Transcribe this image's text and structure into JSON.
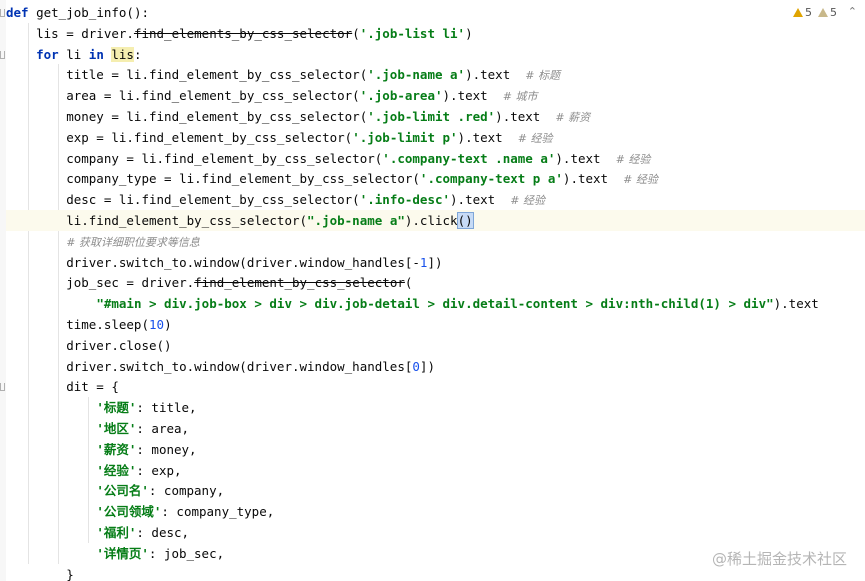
{
  "editor": {
    "lines": [
      [
        {
          "t": "def ",
          "c": "kw"
        },
        {
          "t": "get_job_info():"
        }
      ],
      [
        {
          "t": "    lis = driver."
        },
        {
          "t": "find_elements_by_css_selector",
          "c": "dep"
        },
        {
          "t": "("
        },
        {
          "t": "'.job-list li'",
          "c": "str"
        },
        {
          "t": ")"
        }
      ],
      [
        {
          "t": "    "
        },
        {
          "t": "for ",
          "c": "kw"
        },
        {
          "t": "li "
        },
        {
          "t": "in ",
          "c": "kw"
        },
        {
          "t": "lis",
          "c": "hl-var"
        },
        {
          "t": ":"
        }
      ],
      [
        {
          "t": "        title = li.find_element_by_css_selector("
        },
        {
          "t": "'.job-name a'",
          "c": "str"
        },
        {
          "t": ").text  "
        },
        {
          "t": "# 标题",
          "c": "cmt"
        }
      ],
      [
        {
          "t": "        area = li.find_element_by_css_selector("
        },
        {
          "t": "'.job-area'",
          "c": "str"
        },
        {
          "t": ").text  "
        },
        {
          "t": "# 城市",
          "c": "cmt"
        }
      ],
      [
        {
          "t": "        money = li.find_element_by_css_selector("
        },
        {
          "t": "'.job-limit .red'",
          "c": "str"
        },
        {
          "t": ").text  "
        },
        {
          "t": "# 薪资",
          "c": "cmt"
        }
      ],
      [
        {
          "t": "        exp = li.find_element_by_css_selector("
        },
        {
          "t": "'.job-limit p'",
          "c": "str"
        },
        {
          "t": ").text  "
        },
        {
          "t": "# 经验",
          "c": "cmt"
        }
      ],
      [
        {
          "t": "        company = li.find_element_by_css_selector("
        },
        {
          "t": "'.company-text .name a'",
          "c": "str"
        },
        {
          "t": ").text  "
        },
        {
          "t": "# 经验",
          "c": "cmt"
        }
      ],
      [
        {
          "t": "        company_type = li.find_element_by_css_selector("
        },
        {
          "t": "'.company-text p a'",
          "c": "str"
        },
        {
          "t": ").text  "
        },
        {
          "t": "# 经验",
          "c": "cmt"
        }
      ],
      [
        {
          "t": "        desc = li.find_element_by_css_selector("
        },
        {
          "t": "'.info-desc'",
          "c": "str"
        },
        {
          "t": ").text  "
        },
        {
          "t": "# 经验",
          "c": "cmt"
        }
      ],
      [
        {
          "t": "        li.find_element_by_css_selector("
        },
        {
          "t": "\".job-name a\"",
          "c": "str"
        },
        {
          "t": ").click"
        },
        {
          "t": "()",
          "c": "paren-match"
        },
        {
          "t": "",
          "c": "caret"
        }
      ],
      [
        {
          "t": "        "
        },
        {
          "t": "# 获取详细职位要求等信息",
          "c": "cmt"
        }
      ],
      [
        {
          "t": "        driver.switch_to.window(driver.window_handles[-"
        },
        {
          "t": "1",
          "c": "num"
        },
        {
          "t": "])"
        }
      ],
      [
        {
          "t": "        job_sec = driver."
        },
        {
          "t": "find_element_by_css_selector",
          "c": "dep"
        },
        {
          "t": "("
        }
      ],
      [
        {
          "t": "            "
        },
        {
          "t": "\"#main > div.job-box > div > div.job-detail > div.detail-content > div:nth-child(1) > div\"",
          "c": "str"
        },
        {
          "t": ").text"
        }
      ],
      [
        {
          "t": "        time.sleep("
        },
        {
          "t": "10",
          "c": "num"
        },
        {
          "t": ")"
        }
      ],
      [
        {
          "t": "        driver.close()"
        }
      ],
      [
        {
          "t": "        driver.switch_to.window(driver.window_handles["
        },
        {
          "t": "0",
          "c": "num"
        },
        {
          "t": "])"
        }
      ],
      [
        {
          "t": "        dit = {"
        }
      ],
      [
        {
          "t": "            "
        },
        {
          "t": "'标题'",
          "c": "str"
        },
        {
          "t": ": title,"
        }
      ],
      [
        {
          "t": "            "
        },
        {
          "t": "'地区'",
          "c": "str"
        },
        {
          "t": ": area,"
        }
      ],
      [
        {
          "t": "            "
        },
        {
          "t": "'薪资'",
          "c": "str"
        },
        {
          "t": ": money,"
        }
      ],
      [
        {
          "t": "            "
        },
        {
          "t": "'经验'",
          "c": "str"
        },
        {
          "t": ": exp,"
        }
      ],
      [
        {
          "t": "            "
        },
        {
          "t": "'公司名'",
          "c": "str"
        },
        {
          "t": ": company,"
        }
      ],
      [
        {
          "t": "            "
        },
        {
          "t": "'公司领域'",
          "c": "str"
        },
        {
          "t": ": company_type,"
        }
      ],
      [
        {
          "t": "            "
        },
        {
          "t": "'福利'",
          "c": "str"
        },
        {
          "t": ": desc,"
        }
      ],
      [
        {
          "t": "            "
        },
        {
          "t": "'详情页'",
          "c": "str"
        },
        {
          "t": ": job_sec,"
        }
      ],
      [
        {
          "t": "        }"
        }
      ]
    ],
    "current_line": 10
  },
  "inspections": {
    "warnings": "5",
    "weak_warnings": "5",
    "fold_icon": "chevron-up-icon"
  },
  "watermark": "@稀土掘金技术社区",
  "colors": {
    "keyword": "#0033b3",
    "string": "#067d17",
    "number": "#1750eb",
    "comment": "#8c8c8c",
    "current_line_bg": "#fcfaed"
  }
}
